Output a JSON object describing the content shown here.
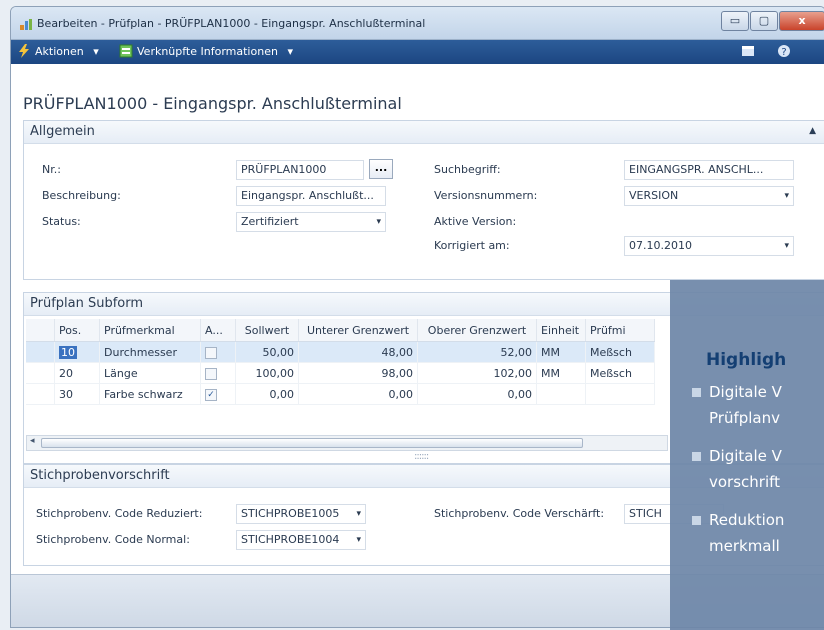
{
  "window": {
    "title": "Bearbeiten - Prüfplan - PRÜFPLAN1000 - Eingangspr. Anschlußterminal",
    "buttons": [
      "▭",
      "▢",
      "x"
    ]
  },
  "actionbar": {
    "actions_label": "Aktionen",
    "linked_info_label": "Verknüpfte Informationen",
    "dropdown_glyph": "▾"
  },
  "page": {
    "title": "PRÜFPLAN1000 - Eingangspr. Anschlußterminal"
  },
  "allgemein": {
    "header": "Allgemein",
    "collapse_glyph": "▲",
    "fields": {
      "nr_label": "Nr.:",
      "nr_value": "PRÜFPLAN1000",
      "beschreibung_label": "Beschreibung:",
      "beschreibung_value": "Eingangspr. Anschlußt...",
      "status_label": "Status:",
      "status_value": "Zertifiziert",
      "suchbegriff_label": "Suchbegriff:",
      "suchbegriff_value": "EINGANGSPR. ANSCHL...",
      "versionsnummern_label": "Versionsnummern:",
      "versionsnummern_value": "VERSION",
      "aktive_version_label": "Aktive Version:",
      "korrigiert_label": "Korrigiert am:",
      "korrigiert_value": "07.10.2010",
      "ellipsis": "..."
    }
  },
  "subform": {
    "header": "Prüfplan Subform",
    "columns": [
      "Pos.",
      "Prüfmerkmal",
      "A...",
      "Sollwert",
      "Unterer Grenzwert",
      "Oberer Grenzwert",
      "Einheit",
      "Prüfmi"
    ],
    "rows": [
      {
        "pos": "10",
        "merkmal": "Durchmesser",
        "check": "",
        "soll": "50,00",
        "unten": "48,00",
        "oben": "52,00",
        "einheit": "MM",
        "pruefmittel": "Meßsch"
      },
      {
        "pos": "20",
        "merkmal": "Länge",
        "check": "",
        "soll": "100,00",
        "unten": "98,00",
        "oben": "102,00",
        "einheit": "MM",
        "pruefmittel": "Meßsch"
      },
      {
        "pos": "30",
        "merkmal": "Farbe schwarz",
        "check": "✓",
        "soll": "0,00",
        "unten": "0,00",
        "oben": "0,00",
        "einheit": "",
        "pruefmittel": ""
      }
    ]
  },
  "stichprobe": {
    "header": "Stichprobenvorschrift",
    "reduziert_label": "Stichprobenv. Code Reduziert:",
    "reduziert_value": "STICHPROBE1005",
    "normal_label": "Stichprobenv. Code Normal:",
    "normal_value": "STICHPROBE1004",
    "verschaerft_label": "Stichprobenv. Code Verschärft:",
    "verschaerft_value": "STICH"
  },
  "highlights": {
    "title": "Highligh",
    "items": [
      {
        "line1": "Digitale V",
        "line2": "Prüfplanv"
      },
      {
        "line1": "Digitale V",
        "line2": "vorschrift"
      },
      {
        "line1": "Reduktion",
        "line2": "merkmall"
      }
    ]
  }
}
